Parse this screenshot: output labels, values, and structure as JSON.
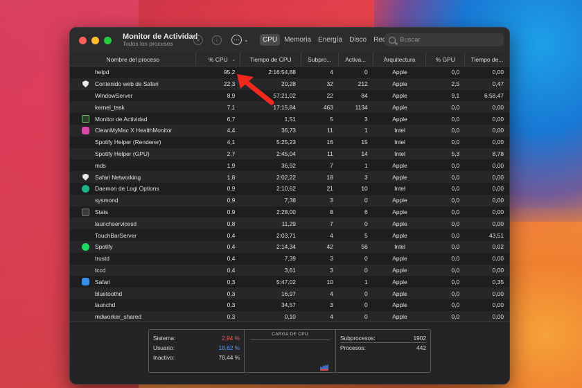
{
  "window": {
    "title": "Monitor de Actividad",
    "subtitle": "Todos los procesos"
  },
  "tabs": [
    {
      "label": "CPU",
      "active": true
    },
    {
      "label": "Memoria",
      "active": false
    },
    {
      "label": "Energía",
      "active": false
    },
    {
      "label": "Disco",
      "active": false
    },
    {
      "label": "Red",
      "active": false
    }
  ],
  "search": {
    "placeholder": "Buscar"
  },
  "columns": {
    "name": "Nombre del proceso",
    "cpu": "% CPU",
    "time": "Tiempo de CPU",
    "threads": "Subpro...",
    "idle": "Activa...",
    "arch": "Arquitectura",
    "gpu": "% GPU",
    "gputime": "Tiempo de..."
  },
  "rows": [
    {
      "name": "helpd",
      "icon": "none",
      "cpu": "95,2",
      "time": "2:16:54,88",
      "threads": "4",
      "idle": "0",
      "arch": "Apple",
      "gpu": "0,0",
      "gputime": "0,00"
    },
    {
      "name": "Contenido web de Safari",
      "icon": "shield-icon",
      "cpu": "22,3",
      "time": "20,28",
      "threads": "32",
      "idle": "212",
      "arch": "Apple",
      "gpu": "2,5",
      "gputime": "0,47"
    },
    {
      "name": "WindowServer",
      "icon": "none",
      "cpu": "8,9",
      "time": "57:21,02",
      "threads": "22",
      "idle": "84",
      "arch": "Apple",
      "gpu": "9,1",
      "gputime": "6:58,47"
    },
    {
      "name": "kernel_task",
      "icon": "none",
      "cpu": "7,1",
      "time": "17:15,84",
      "threads": "463",
      "idle": "1134",
      "arch": "Apple",
      "gpu": "0,0",
      "gputime": "0,00"
    },
    {
      "name": "Monitor de Actividad",
      "icon": "activity-monitor-icon",
      "cpu": "6,7",
      "time": "1,51",
      "threads": "5",
      "idle": "3",
      "arch": "Apple",
      "gpu": "0,0",
      "gputime": "0,00"
    },
    {
      "name": "CleanMyMac X HealthMonitor",
      "icon": "cleanmymac-icon",
      "cpu": "4,4",
      "time": "36,73",
      "threads": "11",
      "idle": "1",
      "arch": "Intel",
      "gpu": "0,0",
      "gputime": "0,00"
    },
    {
      "name": "Spotify Helper (Renderer)",
      "icon": "none",
      "cpu": "4,1",
      "time": "5:25,23",
      "threads": "16",
      "idle": "15",
      "arch": "Intel",
      "gpu": "0,0",
      "gputime": "0,00"
    },
    {
      "name": "Spotify Helper (GPU)",
      "icon": "none",
      "cpu": "2,7",
      "time": "2:45,04",
      "threads": "11",
      "idle": "14",
      "arch": "Intel",
      "gpu": "5,3",
      "gputime": "8,78"
    },
    {
      "name": "mds",
      "icon": "none",
      "cpu": "1,9",
      "time": "36,92",
      "threads": "7",
      "idle": "1",
      "arch": "Apple",
      "gpu": "0,0",
      "gputime": "0,00"
    },
    {
      "name": "Safari Networking",
      "icon": "shield-icon",
      "cpu": "1,8",
      "time": "2:02,22",
      "threads": "18",
      "idle": "3",
      "arch": "Apple",
      "gpu": "0,0",
      "gputime": "0,00"
    },
    {
      "name": "Daemon de Logi Options",
      "icon": "logi-icon",
      "cpu": "0,9",
      "time": "2:10,62",
      "threads": "21",
      "idle": "10",
      "arch": "Intel",
      "gpu": "0,0",
      "gputime": "0,00"
    },
    {
      "name": "sysmond",
      "icon": "none",
      "cpu": "0,9",
      "time": "7,38",
      "threads": "3",
      "idle": "0",
      "arch": "Apple",
      "gpu": "0,0",
      "gputime": "0,00"
    },
    {
      "name": "Stats",
      "icon": "stats-icon",
      "cpu": "0,9",
      "time": "2:28,00",
      "threads": "8",
      "idle": "6",
      "arch": "Apple",
      "gpu": "0,0",
      "gputime": "0,00"
    },
    {
      "name": "launchservicesd",
      "icon": "none",
      "cpu": "0,8",
      "time": "11,29",
      "threads": "7",
      "idle": "0",
      "arch": "Apple",
      "gpu": "0,0",
      "gputime": "0,00"
    },
    {
      "name": "TouchBarServer",
      "icon": "none",
      "cpu": "0,4",
      "time": "2:03,71",
      "threads": "4",
      "idle": "5",
      "arch": "Apple",
      "gpu": "0,0",
      "gputime": "43,51"
    },
    {
      "name": "Spotify",
      "icon": "spotify-icon",
      "cpu": "0,4",
      "time": "2:14,34",
      "threads": "42",
      "idle": "56",
      "arch": "Intel",
      "gpu": "0,0",
      "gputime": "0,02"
    },
    {
      "name": "trustd",
      "icon": "none",
      "cpu": "0,4",
      "time": "7,39",
      "threads": "3",
      "idle": "0",
      "arch": "Apple",
      "gpu": "0,0",
      "gputime": "0,00"
    },
    {
      "name": "tccd",
      "icon": "none",
      "cpu": "0,4",
      "time": "3,61",
      "threads": "3",
      "idle": "0",
      "arch": "Apple",
      "gpu": "0,0",
      "gputime": "0,00"
    },
    {
      "name": "Safari",
      "icon": "safari-icon",
      "cpu": "0,3",
      "time": "5:47,02",
      "threads": "10",
      "idle": "1",
      "arch": "Apple",
      "gpu": "0,0",
      "gputime": "0,35"
    },
    {
      "name": "bluetoothd",
      "icon": "none",
      "cpu": "0,3",
      "time": "16,97",
      "threads": "4",
      "idle": "0",
      "arch": "Apple",
      "gpu": "0,0",
      "gputime": "0,00"
    },
    {
      "name": "launchd",
      "icon": "none",
      "cpu": "0,3",
      "time": "34,57",
      "threads": "3",
      "idle": "0",
      "arch": "Apple",
      "gpu": "0,0",
      "gputime": "0,00"
    },
    {
      "name": "mdworker_shared",
      "icon": "none",
      "cpu": "0,3",
      "time": "0,10",
      "threads": "4",
      "idle": "0",
      "arch": "Apple",
      "gpu": "0,0",
      "gputime": "0,00"
    }
  ],
  "footer": {
    "sistema_label": "Sistema:",
    "sistema_value": "2,94 %",
    "usuario_label": "Usuario:",
    "usuario_value": "18,62 %",
    "inactivo_label": "Inactivo:",
    "inactivo_value": "78,44 %",
    "graph_title": "CARGA DE CPU",
    "subprocesos_label": "Subprocesos:",
    "subprocesos_value": "1902",
    "procesos_label": "Procesos:",
    "procesos_value": "442"
  },
  "colors": {
    "sistema": "#ff5b55",
    "usuario": "#4ea3ff",
    "annotation_arrow": "#f0281e"
  }
}
